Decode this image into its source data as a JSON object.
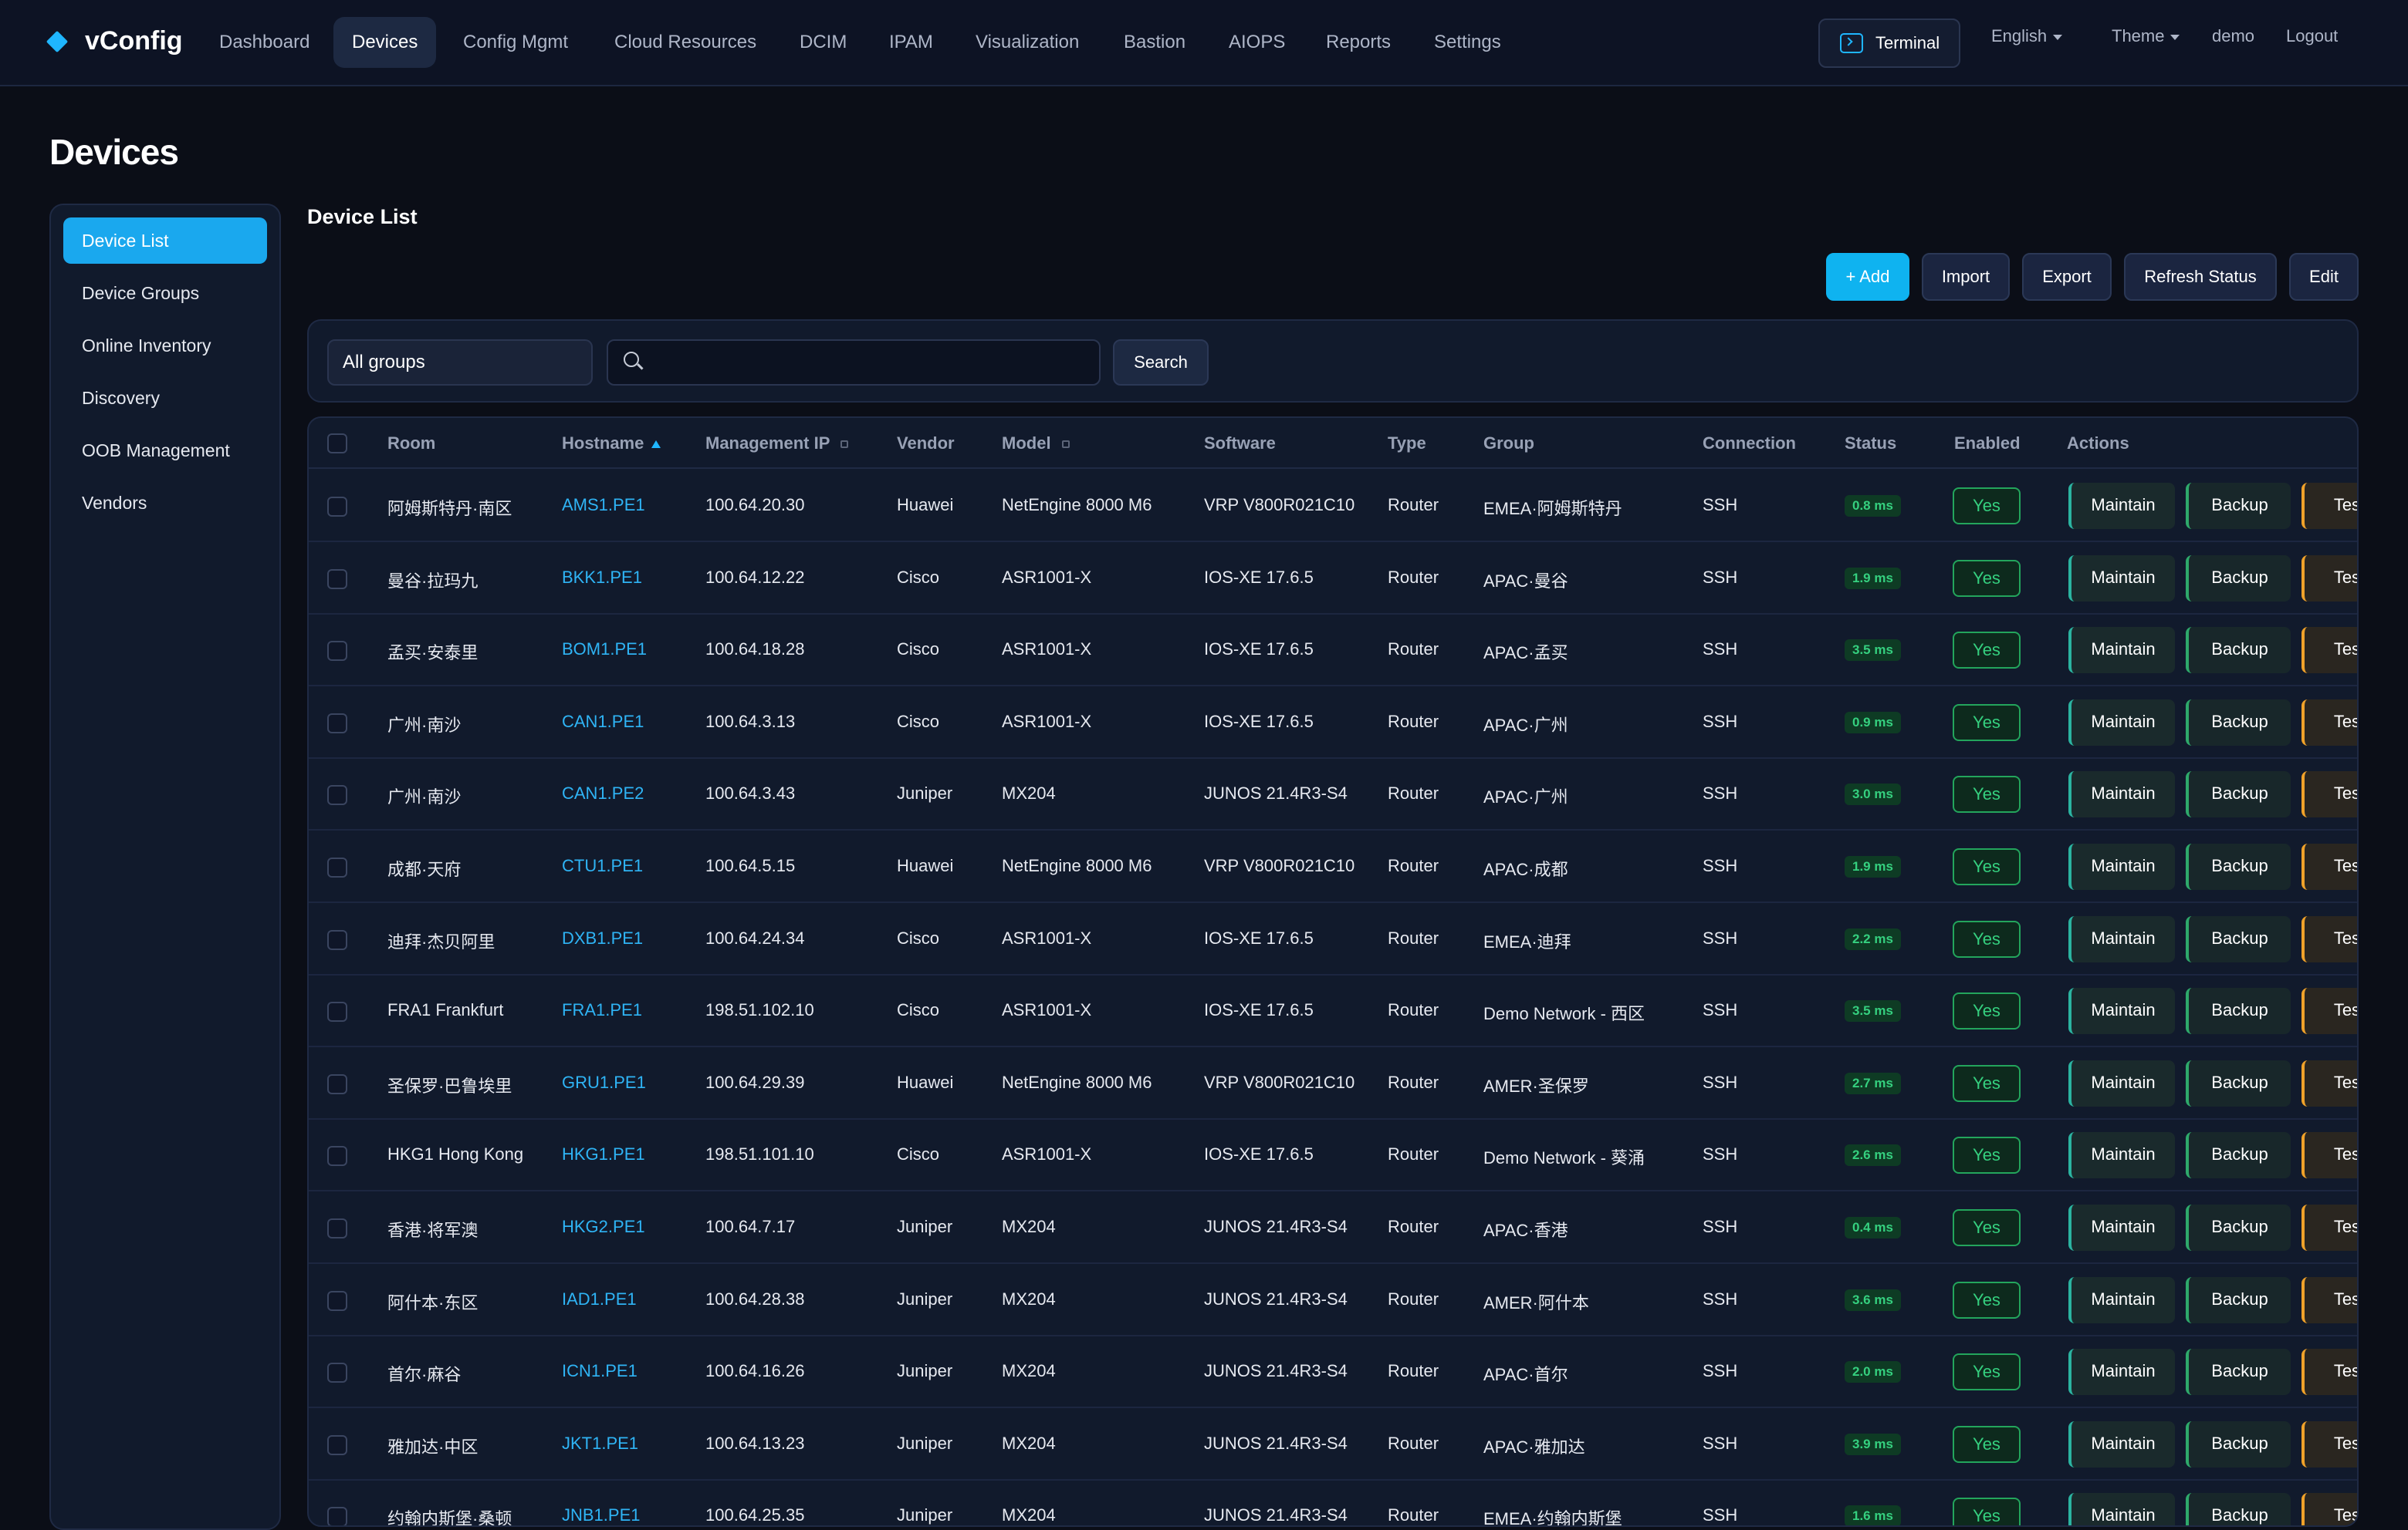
{
  "app": {
    "name": "vConfig"
  },
  "nav": {
    "items": [
      "Dashboard",
      "Devices",
      "Config Mgmt",
      "Cloud Resources",
      "DCIM",
      "IPAM",
      "Visualization",
      "Bastion",
      "AIOPS",
      "Reports",
      "Settings"
    ],
    "active": "Devices",
    "terminal_label": "Terminal",
    "language": "English",
    "theme": "Theme",
    "user": "demo",
    "logout": "Logout"
  },
  "page": {
    "title": "Devices",
    "section_title": "Device List"
  },
  "sidebar": {
    "items": [
      "Device List",
      "Device Groups",
      "Online Inventory",
      "Discovery",
      "OOB Management",
      "Vendors"
    ],
    "active": "Device List"
  },
  "toolbar": {
    "add": "+ Add",
    "import": "Import",
    "export": "Export",
    "refresh": "Refresh Status",
    "edit": "Edit"
  },
  "filters": {
    "group_value": "All groups",
    "search_value": "",
    "search_placeholder": "",
    "search_button": "Search"
  },
  "table": {
    "columns": [
      "Room",
      "Hostname",
      "Management IP",
      "Vendor",
      "Model",
      "Software",
      "Type",
      "Group",
      "Connection",
      "Status",
      "Enabled",
      "Actions"
    ],
    "sorted_column": "Hostname",
    "sort_direction": "ascending",
    "action_labels": {
      "maintain": "Maintain",
      "backup": "Backup",
      "test": "Test"
    },
    "rows": [
      {
        "room": "阿姆斯特丹·南区",
        "hostname": "AMS1.PE1",
        "ip": "100.64.20.30",
        "vendor": "Huawei",
        "model": "NetEngine 8000 M6",
        "software": "VRP V800R021C10",
        "type": "Router",
        "group": "EMEA·阿姆斯特丹",
        "connection": "SSH",
        "status": "0.8 ms",
        "enabled": "Yes"
      },
      {
        "room": "曼谷·拉玛九",
        "hostname": "BKK1.PE1",
        "ip": "100.64.12.22",
        "vendor": "Cisco",
        "model": "ASR1001-X",
        "software": "IOS-XE 17.6.5",
        "type": "Router",
        "group": "APAC·曼谷",
        "connection": "SSH",
        "status": "1.9 ms",
        "enabled": "Yes"
      },
      {
        "room": "孟买·安泰里",
        "hostname": "BOM1.PE1",
        "ip": "100.64.18.28",
        "vendor": "Cisco",
        "model": "ASR1001-X",
        "software": "IOS-XE 17.6.5",
        "type": "Router",
        "group": "APAC·孟买",
        "connection": "SSH",
        "status": "3.5 ms",
        "enabled": "Yes"
      },
      {
        "room": "广州·南沙",
        "hostname": "CAN1.PE1",
        "ip": "100.64.3.13",
        "vendor": "Cisco",
        "model": "ASR1001-X",
        "software": "IOS-XE 17.6.5",
        "type": "Router",
        "group": "APAC·广州",
        "connection": "SSH",
        "status": "0.9 ms",
        "enabled": "Yes"
      },
      {
        "room": "广州·南沙",
        "hostname": "CAN1.PE2",
        "ip": "100.64.3.43",
        "vendor": "Juniper",
        "model": "MX204",
        "software": "JUNOS 21.4R3-S4",
        "type": "Router",
        "group": "APAC·广州",
        "connection": "SSH",
        "status": "3.0 ms",
        "enabled": "Yes"
      },
      {
        "room": "成都·天府",
        "hostname": "CTU1.PE1",
        "ip": "100.64.5.15",
        "vendor": "Huawei",
        "model": "NetEngine 8000 M6",
        "software": "VRP V800R021C10",
        "type": "Router",
        "group": "APAC·成都",
        "connection": "SSH",
        "status": "1.9 ms",
        "enabled": "Yes"
      },
      {
        "room": "迪拜·杰贝阿里",
        "hostname": "DXB1.PE1",
        "ip": "100.64.24.34",
        "vendor": "Cisco",
        "model": "ASR1001-X",
        "software": "IOS-XE 17.6.5",
        "type": "Router",
        "group": "EMEA·迪拜",
        "connection": "SSH",
        "status": "2.2 ms",
        "enabled": "Yes"
      },
      {
        "room": "FRA1 Frankfurt",
        "hostname": "FRA1.PE1",
        "ip": "198.51.102.10",
        "vendor": "Cisco",
        "model": "ASR1001-X",
        "software": "IOS-XE 17.6.5",
        "type": "Router",
        "group": "Demo Network - 西区",
        "connection": "SSH",
        "status": "3.5 ms",
        "enabled": "Yes"
      },
      {
        "room": "圣保罗·巴鲁埃里",
        "hostname": "GRU1.PE1",
        "ip": "100.64.29.39",
        "vendor": "Huawei",
        "model": "NetEngine 8000 M6",
        "software": "VRP V800R021C10",
        "type": "Router",
        "group": "AMER·圣保罗",
        "connection": "SSH",
        "status": "2.7 ms",
        "enabled": "Yes"
      },
      {
        "room": "HKG1 Hong Kong",
        "hostname": "HKG1.PE1",
        "ip": "198.51.101.10",
        "vendor": "Cisco",
        "model": "ASR1001-X",
        "software": "IOS-XE 17.6.5",
        "type": "Router",
        "group": "Demo Network - 葵涌",
        "connection": "SSH",
        "status": "2.6 ms",
        "enabled": "Yes"
      },
      {
        "room": "香港·将军澳",
        "hostname": "HKG2.PE1",
        "ip": "100.64.7.17",
        "vendor": "Juniper",
        "model": "MX204",
        "software": "JUNOS 21.4R3-S4",
        "type": "Router",
        "group": "APAC·香港",
        "connection": "SSH",
        "status": "0.4 ms",
        "enabled": "Yes"
      },
      {
        "room": "阿什本·东区",
        "hostname": "IAD1.PE1",
        "ip": "100.64.28.38",
        "vendor": "Juniper",
        "model": "MX204",
        "software": "JUNOS 21.4R3-S4",
        "type": "Router",
        "group": "AMER·阿什本",
        "connection": "SSH",
        "status": "3.6 ms",
        "enabled": "Yes"
      },
      {
        "room": "首尔·麻谷",
        "hostname": "ICN1.PE1",
        "ip": "100.64.16.26",
        "vendor": "Juniper",
        "model": "MX204",
        "software": "JUNOS 21.4R3-S4",
        "type": "Router",
        "group": "APAC·首尔",
        "connection": "SSH",
        "status": "2.0 ms",
        "enabled": "Yes"
      },
      {
        "room": "雅加达·中区",
        "hostname": "JKT1.PE1",
        "ip": "100.64.13.23",
        "vendor": "Juniper",
        "model": "MX204",
        "software": "JUNOS 21.4R3-S4",
        "type": "Router",
        "group": "APAC·雅加达",
        "connection": "SSH",
        "status": "3.9 ms",
        "enabled": "Yes"
      },
      {
        "room": "约翰内斯堡·桑顿",
        "hostname": "JNB1.PE1",
        "ip": "100.64.25.35",
        "vendor": "Juniper",
        "model": "MX204",
        "software": "JUNOS 21.4R3-S4",
        "type": "Router",
        "group": "EMEA·约翰内斯堡",
        "connection": "SSH",
        "status": "1.6 ms",
        "enabled": "Yes"
      }
    ]
  },
  "colors": {
    "accent": "#1fb6ff",
    "primary_button": "#0fb3f0",
    "status_ok": "#35d07f",
    "test_accent": "#f0a22a"
  }
}
